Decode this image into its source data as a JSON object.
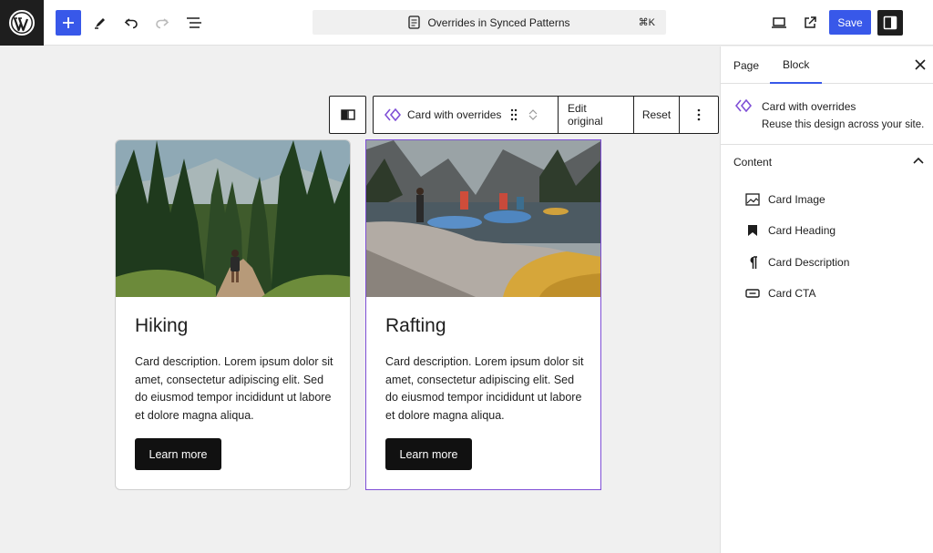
{
  "header": {
    "document_title": "Overrides in Synced Patterns",
    "shortcut": "⌘K",
    "save_label": "Save"
  },
  "block_toolbar": {
    "block_name": "Card with overrides",
    "edit_original_label": "Edit original",
    "reset_label": "Reset"
  },
  "cards": [
    {
      "title": "Hiking",
      "description": "Card description. Lorem ipsum dolor sit amet, consectetur adipiscing elit. Sed do eiusmod tempor incididunt ut labore et dolore magna aliqua.",
      "cta": "Learn more",
      "image": "forest-trail-hiker-photo"
    },
    {
      "title": "Rafting",
      "description": "Card description. Lorem ipsum dolor sit amet, consectetur adipiscing elit. Sed do eiusmod tempor incididunt ut labore et dolore magna aliqua.",
      "cta": "Learn more",
      "image": "river-rafting-photo",
      "selected": true
    }
  ],
  "sidebar": {
    "tabs": [
      {
        "label": "Page",
        "active": false
      },
      {
        "label": "Block",
        "active": true
      }
    ],
    "block_card": {
      "name": "Card with overrides",
      "description": "Reuse this design across your site."
    },
    "content_panel": {
      "title": "Content",
      "expanded": true,
      "items": [
        {
          "label": "Card Image",
          "icon": "image-icon"
        },
        {
          "label": "Card Heading",
          "icon": "bookmark-icon"
        },
        {
          "label": "Card Description",
          "icon": "paragraph-icon"
        },
        {
          "label": "Card CTA",
          "icon": "button-icon"
        }
      ]
    }
  },
  "colors": {
    "accent": "#3858e9",
    "synced_pattern": "#7f4fd6",
    "dark": "#1e1e1e"
  }
}
